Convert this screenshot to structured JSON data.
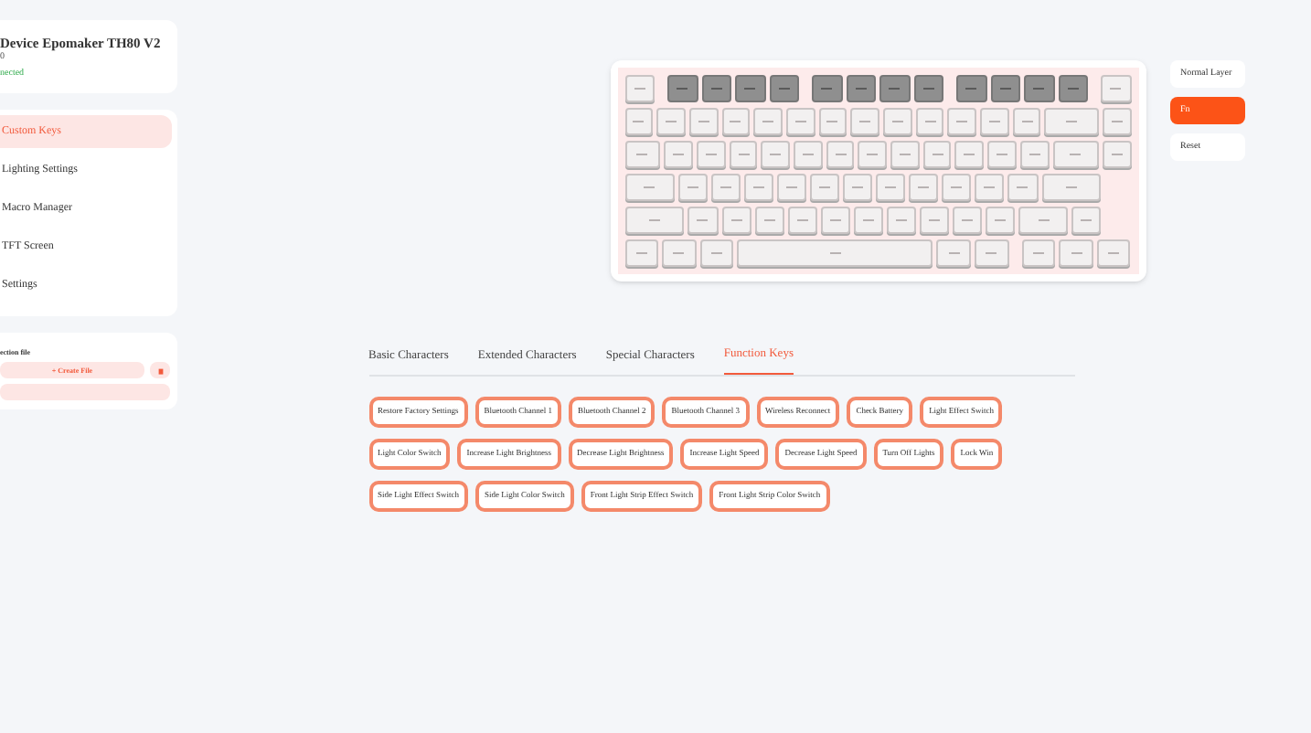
{
  "device": {
    "title": "Device Epomaker TH80 V2",
    "subtitle": "0",
    "status": "nected"
  },
  "nav": [
    {
      "label": "Custom Keys",
      "selected": true
    },
    {
      "label": "Lighting Settings",
      "selected": false
    },
    {
      "label": "Macro Manager",
      "selected": false
    },
    {
      "label": "TFT Screen",
      "selected": false
    },
    {
      "label": "Settings",
      "selected": false
    }
  ],
  "files": {
    "label": "ection file",
    "create_button": "+ Create File"
  },
  "keyboard": {
    "rows": [
      [
        {
          "kind": "normal"
        },
        {
          "kind": "dark"
        },
        {
          "kind": "dark"
        },
        {
          "kind": "dark"
        },
        {
          "kind": "dark"
        },
        {
          "kind": "dark"
        },
        {
          "kind": "dark"
        },
        {
          "kind": "dark"
        },
        {
          "kind": "dark"
        },
        {
          "kind": "dark"
        },
        {
          "kind": "dark"
        },
        {
          "kind": "dark"
        },
        {
          "kind": "dark"
        },
        {
          "kind": "normal"
        }
      ],
      [
        {
          "kind": "normal"
        },
        {
          "kind": "normal"
        },
        {
          "kind": "normal"
        },
        {
          "kind": "normal"
        },
        {
          "kind": "normal"
        },
        {
          "kind": "normal"
        },
        {
          "kind": "normal"
        },
        {
          "kind": "normal"
        },
        {
          "kind": "normal"
        },
        {
          "kind": "normal"
        },
        {
          "kind": "normal"
        },
        {
          "kind": "normal"
        },
        {
          "kind": "normal"
        },
        {
          "kind": "normal"
        },
        {
          "kind": "normal"
        }
      ],
      [
        {
          "kind": "normal"
        },
        {
          "kind": "normal"
        },
        {
          "kind": "normal"
        },
        {
          "kind": "normal"
        },
        {
          "kind": "normal"
        },
        {
          "kind": "normal"
        },
        {
          "kind": "normal"
        },
        {
          "kind": "normal"
        },
        {
          "kind": "normal"
        },
        {
          "kind": "normal"
        },
        {
          "kind": "normal"
        },
        {
          "kind": "normal"
        },
        {
          "kind": "normal"
        },
        {
          "kind": "normal"
        },
        {
          "kind": "normal"
        }
      ],
      [
        {
          "kind": "normal"
        },
        {
          "kind": "normal"
        },
        {
          "kind": "normal"
        },
        {
          "kind": "normal"
        },
        {
          "kind": "normal"
        },
        {
          "kind": "normal"
        },
        {
          "kind": "normal"
        },
        {
          "kind": "normal"
        },
        {
          "kind": "normal"
        },
        {
          "kind": "normal"
        },
        {
          "kind": "normal"
        },
        {
          "kind": "normal"
        },
        {
          "kind": "normal"
        }
      ],
      [
        {
          "kind": "normal"
        },
        {
          "kind": "normal"
        },
        {
          "kind": "normal"
        },
        {
          "kind": "normal"
        },
        {
          "kind": "normal"
        },
        {
          "kind": "normal"
        },
        {
          "kind": "normal"
        },
        {
          "kind": "normal"
        },
        {
          "kind": "normal"
        },
        {
          "kind": "normal"
        },
        {
          "kind": "normal"
        },
        {
          "kind": "normal"
        },
        {
          "kind": "normal"
        }
      ],
      [
        {
          "kind": "normal"
        },
        {
          "kind": "normal"
        },
        {
          "kind": "normal"
        },
        {
          "kind": "normal"
        },
        {
          "kind": "normal"
        },
        {
          "kind": "normal"
        },
        {
          "kind": "normal"
        },
        {
          "kind": "normal"
        },
        {
          "kind": "normal"
        }
      ]
    ]
  },
  "layers": [
    {
      "label": "Normal Layer",
      "selected": false
    },
    {
      "label": "Fn",
      "selected": true
    }
  ],
  "reset_button": "Reset",
  "tabs": [
    {
      "label": "Basic Characters",
      "selected": false
    },
    {
      "label": "Extended Characters",
      "selected": false
    },
    {
      "label": "Special Characters",
      "selected": false
    },
    {
      "label": "Function Keys",
      "selected": true
    }
  ],
  "function_keys": [
    "Restore Factory Settings",
    "Bluetooth Channel 1",
    "Bluetooth Channel 2",
    "Bluetooth Channel 3",
    "Wireless Reconnect",
    "Check Battery",
    "Light Effect Switch",
    "Light Color Switch",
    "Increase Light Brightness",
    "Decrease Light Brightness",
    "Increase Light Speed",
    "Decrease Light Speed",
    "Turn Off Lights",
    "Lock Win",
    "Side Light Effect Switch",
    "Side Light Color Switch",
    "Front Light Strip Effect Switch",
    "Front Light Strip Color Switch"
  ]
}
